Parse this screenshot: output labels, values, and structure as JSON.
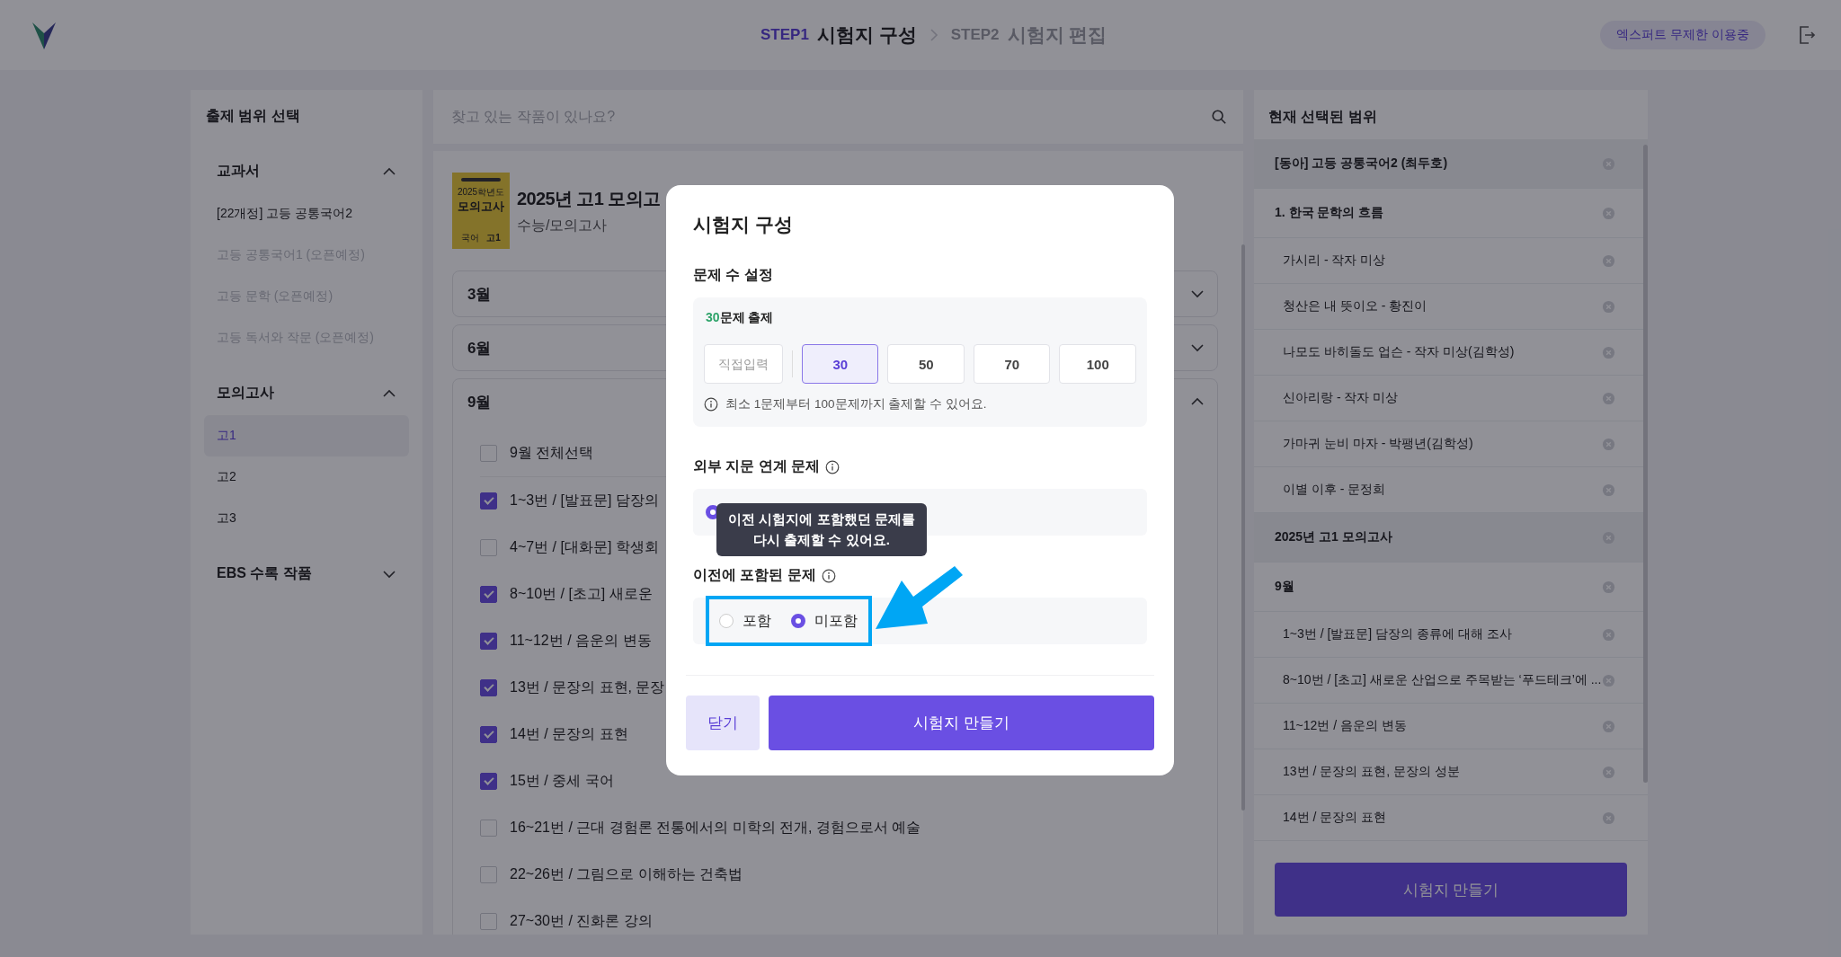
{
  "header": {
    "steps": [
      {
        "label": "STEP1",
        "title": "시험지 구성",
        "selected": true
      },
      {
        "label": "STEP2",
        "title": "시험지 편집",
        "selected": false
      }
    ],
    "badge": "엑스퍼트 무제한 이용중"
  },
  "sidebar": {
    "title": "출제 범위 선택",
    "groups": [
      {
        "label": "교과서",
        "expanded": true,
        "items": [
          {
            "label": "[22개정] 고등 공통국어2",
            "selected": false,
            "disabled": false
          },
          {
            "label": "고등 공통국어1 (오픈예정)",
            "selected": false,
            "disabled": true
          },
          {
            "label": "고등 문학 (오픈예정)",
            "selected": false,
            "disabled": true
          },
          {
            "label": "고등 독서와 작문 (오픈예정)",
            "selected": false,
            "disabled": true
          }
        ]
      },
      {
        "label": "모의고사",
        "expanded": true,
        "items": [
          {
            "label": "고1",
            "selected": true,
            "disabled": false
          },
          {
            "label": "고2",
            "selected": false,
            "disabled": false
          },
          {
            "label": "고3",
            "selected": false,
            "disabled": false
          }
        ]
      },
      {
        "label": "EBS 수록 작품",
        "expanded": false
      }
    ]
  },
  "search": {
    "placeholder": "찾고 있는 작품이 있나요?"
  },
  "work": {
    "cover": {
      "top": "2025학년도",
      "title": "모의고사",
      "subject": "국어",
      "grade": "고1"
    },
    "title": "2025년 고1 모의고",
    "subtitle": "수능/모의고사",
    "months": [
      {
        "label": "3월",
        "expanded": false
      },
      {
        "label": "6월",
        "expanded": false
      },
      {
        "label": "9월",
        "expanded": true,
        "items": [
          {
            "label": "9월 전체선택",
            "checked": false
          },
          {
            "label": "1~3번 / [발표문] 담장의",
            "checked": true
          },
          {
            "label": "4~7번 / [대화문] 학생회",
            "checked": false
          },
          {
            "label": "8~10번 / [초고] 새로운",
            "checked": true
          },
          {
            "label": "11~12번 / 음운의 변동",
            "checked": true
          },
          {
            "label": "13번 / 문장의 표현, 문장",
            "checked": true
          },
          {
            "label": "14번 / 문장의 표현",
            "checked": true
          },
          {
            "label": "15번 / 중세 국어",
            "checked": true
          },
          {
            "label": "16~21번 / 근대 경험론 전통에서의 미학의 전개, 경험으로서 예술",
            "checked": false
          },
          {
            "label": "22~26번 / 그림으로 이해하는 건축법",
            "checked": false
          },
          {
            "label": "27~30번 / 진화론 강의",
            "checked": false
          }
        ]
      }
    ]
  },
  "modal": {
    "title": "시험지 구성",
    "count_section": {
      "label": "문제 수 설정",
      "count": "30",
      "suffix": "문제 출제",
      "input_placeholder": "직접입력",
      "options": [
        {
          "label": "30",
          "selected": true
        },
        {
          "label": "50",
          "selected": false
        },
        {
          "label": "70",
          "selected": false
        },
        {
          "label": "100",
          "selected": false
        }
      ],
      "hint": "최소 1문제부터 100문제까지 출제할 수 있어요."
    },
    "external": {
      "label": "외부 지문 연계 문제",
      "options": [
        {
          "selected": true
        }
      ]
    },
    "tooltip": "이전 시험지에 포함했던 문제를\n다시 출제할 수 있어요.",
    "previous": {
      "label": "이전에 포함된 문제",
      "options": [
        {
          "label": "포함",
          "selected": false
        },
        {
          "label": "미포함",
          "selected": true
        }
      ]
    },
    "buttons": [
      {
        "label": "닫기",
        "kind": "secondary"
      },
      {
        "label": "시험지 만들기",
        "kind": "primary"
      }
    ]
  },
  "selection": {
    "title": "현재 선택된 범위",
    "items": [
      {
        "label": "[동아] 고등 공통국어2 (최두호)",
        "kind": "group"
      },
      {
        "label": "1. 한국 문학의 흐름",
        "kind": "section"
      },
      {
        "label": "가시리 - 작자 미상",
        "kind": "item"
      },
      {
        "label": "청산은 내 뜻이오 - 황진이",
        "kind": "item"
      },
      {
        "label": "나모도 바히돌도 업슨 - 작자 미상(김학성)",
        "kind": "item"
      },
      {
        "label": "신아리랑 - 작자 미상",
        "kind": "item"
      },
      {
        "label": "가마귀 눈비 마자 - 박팽년(김학성)",
        "kind": "item"
      },
      {
        "label": "이별 이후 - 문정희",
        "kind": "item"
      },
      {
        "label": "2025년 고1 모의고사",
        "kind": "group"
      },
      {
        "label": "9월",
        "kind": "section"
      },
      {
        "label": "1~3번 / [발표문] 담장의 종류에 대해 조사",
        "kind": "item"
      },
      {
        "label": "8~10번 / [초고] 새로운 산업으로 주목받는 ‘푸드테크’에 ...",
        "kind": "item"
      },
      {
        "label": "11~12번 / 음운의 변동",
        "kind": "item"
      },
      {
        "label": "13번 / 문장의 표현, 문장의 성분",
        "kind": "item"
      },
      {
        "label": "14번 / 문장의 표현",
        "kind": "item"
      }
    ],
    "button": "시험지 만들기"
  }
}
